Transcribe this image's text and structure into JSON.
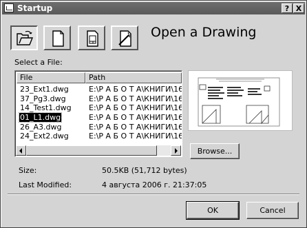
{
  "window": {
    "title": "Startup",
    "help_label": "?",
    "close_label": "X"
  },
  "toolbar": {
    "modes": [
      {
        "name": "open-drawing",
        "icon": "open-folder-icon",
        "active": true
      },
      {
        "name": "start-from-scratch",
        "icon": "blank-page-icon",
        "active": false
      },
      {
        "name": "use-template",
        "icon": "template-page-icon",
        "active": false
      },
      {
        "name": "use-wizard",
        "icon": "wizard-icon",
        "active": false
      }
    ]
  },
  "main": {
    "heading": "Open a Drawing",
    "select_label": "Select a File:",
    "columns": [
      "File",
      "Path"
    ],
    "files": [
      {
        "file": "23_Ext1.dwg",
        "path": "E:\\Р А Б О Т А\\КНИГИ\\16"
      },
      {
        "file": "37_Pg3.dwg",
        "path": "E:\\Р А Б О Т А\\КНИГИ\\16"
      },
      {
        "file": "14_Test1.dwg",
        "path": "E:\\Р А Б О Т А\\КНИГИ\\16"
      },
      {
        "file": "01_L1.dwg",
        "path": "E:\\Р А Б О Т А\\КНИГИ\\16",
        "selected": true
      },
      {
        "file": "26_A3.dwg",
        "path": "E:\\Р А Б О Т А\\КНИГИ\\16"
      },
      {
        "file": "24_Ext2.dwg",
        "path": "E:\\Р А Б О Т А\\КНИГИ\\16"
      }
    ],
    "browse_label": "Browse...",
    "size_label": "Size:",
    "size_value": "50.5KB (51,712 bytes)",
    "modified_label": "Last Modified:",
    "modified_value": "4 августа 2006 г.  21:37:05"
  },
  "footer": {
    "ok_label": "OK",
    "cancel_label": "Cancel"
  }
}
